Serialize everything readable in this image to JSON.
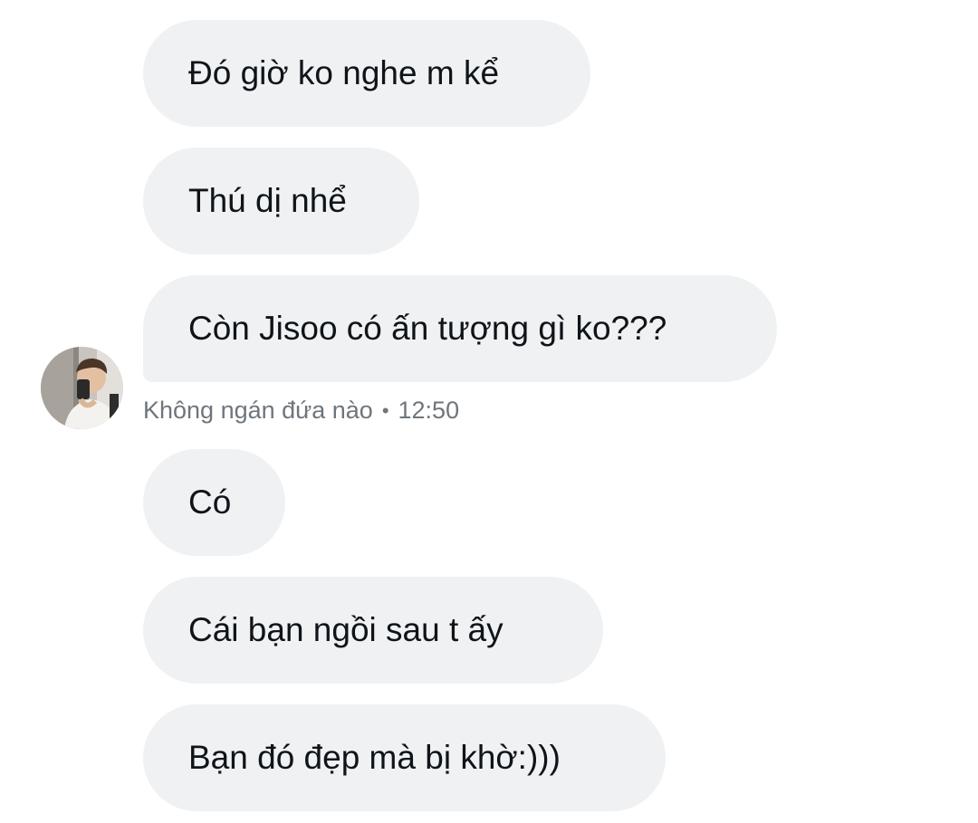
{
  "messages": [
    {
      "text": "Đó giờ ko nghe m kể"
    },
    {
      "text": "Thú dị nhể"
    },
    {
      "text": "Còn Jisoo có ấn tượng gì ko???"
    },
    {
      "text": "Có"
    },
    {
      "text": "Cái bạn ngồi sau t ấy"
    },
    {
      "text": "Bạn đó đẹp mà bị khờ:)))"
    }
  ],
  "meta": {
    "sender": "Không ngán đứa nào",
    "separator": "•",
    "time": "12:50"
  },
  "avatar": {
    "icon": "user-avatar-photo"
  },
  "colors": {
    "bubble": "#eff1f3",
    "text": "#0f1419",
    "meta": "#6e767d"
  }
}
